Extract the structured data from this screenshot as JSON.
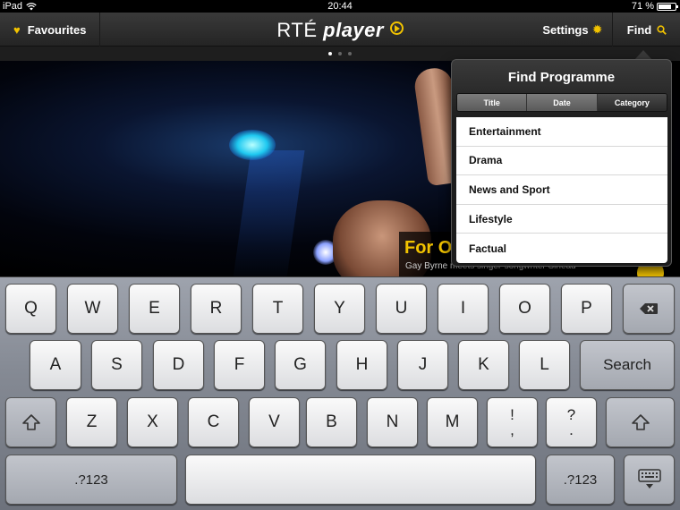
{
  "status": {
    "device": "iPad",
    "time": "20:44",
    "battery": "71 %"
  },
  "nav": {
    "favourites": "Favourites",
    "logo_rte": "RTÉ",
    "logo_player": "player",
    "settings": "Settings",
    "find": "Find"
  },
  "hero": {
    "title": "For O",
    "subtitle": "Gay Byrne meets singer-songwriter Sinead"
  },
  "popover": {
    "title": "Find Programme",
    "segments": [
      "Title",
      "Date",
      "Category"
    ],
    "selected_segment": "Category",
    "items": [
      "Entertainment",
      "Drama",
      "News and Sport",
      "Lifestyle",
      "Factual"
    ]
  },
  "keyboard": {
    "row1": [
      "Q",
      "W",
      "E",
      "R",
      "T",
      "Y",
      "U",
      "I",
      "O",
      "P"
    ],
    "row2": [
      "A",
      "S",
      "D",
      "F",
      "G",
      "H",
      "J",
      "K",
      "L"
    ],
    "row3": [
      "Z",
      "X",
      "C",
      "V",
      "B",
      "N",
      "M"
    ],
    "search": "Search",
    "numbers": ".?123",
    "punct1_top": "!",
    "punct1_bottom": ",",
    "punct2_top": "?",
    "punct2_bottom": "."
  },
  "icons": {
    "wifi": "wifi-icon",
    "heart": "heart-icon",
    "gear": "gear-icon",
    "search": "search-icon",
    "backspace": "backspace-icon",
    "shift": "shift-icon",
    "hide_keyboard": "keyboard-hide-icon"
  },
  "colors": {
    "accent": "#f2c300"
  }
}
